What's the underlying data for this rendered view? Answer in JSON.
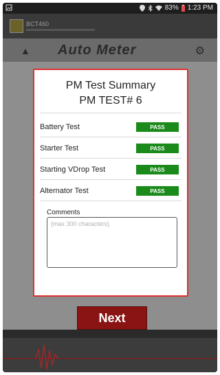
{
  "status_bar": {
    "battery": "83%",
    "time": "1:23 PM",
    "icons": [
      "image-icon",
      "location-icon",
      "bluetooth-icon",
      "wifi-icon",
      "battery-icon"
    ]
  },
  "app_bar": {
    "title": "BCT460"
  },
  "header": {
    "logo": "Auto Meter"
  },
  "dialog": {
    "title": "PM Test Summary",
    "subtitle": "PM TEST# 6",
    "tests": [
      {
        "label": "Battery Test",
        "result": "PASS"
      },
      {
        "label": "Starter Test",
        "result": "PASS"
      },
      {
        "label": "Starting VDrop Test",
        "result": "PASS"
      },
      {
        "label": "Alternator Test",
        "result": "PASS"
      }
    ],
    "comments_label": "Comments",
    "comments_placeholder": "(max 300 characters)",
    "comments_value": ""
  },
  "next_button": {
    "label": "Next"
  },
  "colors": {
    "accent_red": "#8a1414",
    "dialog_border": "#e03030",
    "pass_green": "#1a8a1a"
  }
}
